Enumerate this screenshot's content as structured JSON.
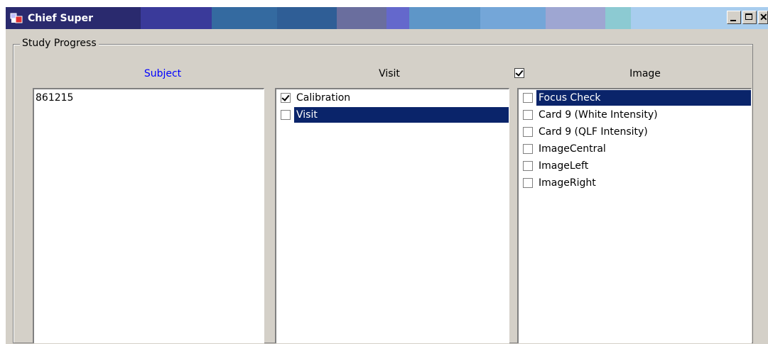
{
  "window": {
    "title": "Chief Super",
    "titlebar_colors": [
      "#2a2a6e",
      "#3a3a9a",
      "#346aa0",
      "#2f5e96",
      "#6a6e9e",
      "#6468cc",
      "#5e96c8",
      "#74a6d8",
      "#9ea6d2",
      "#8ccad2",
      "#a8cdee"
    ]
  },
  "group": {
    "label": "Study Progress"
  },
  "columns": {
    "subject_header": "Subject",
    "subject_header_color": "#0000ff",
    "visit_header": "Visit",
    "image_header": "Image",
    "image_header_checked": true
  },
  "subjects": [
    "861215"
  ],
  "visits": [
    {
      "label": "Calibration",
      "checked": true,
      "selected": false
    },
    {
      "label": "Visit",
      "checked": false,
      "selected": true
    }
  ],
  "images": [
    {
      "label": "Focus Check",
      "checked": false,
      "selected": true
    },
    {
      "label": "Card 9 (White Intensity)",
      "checked": false,
      "selected": false
    },
    {
      "label": "Card 9 (QLF Intensity)",
      "checked": false,
      "selected": false
    },
    {
      "label": "ImageCentral",
      "checked": false,
      "selected": false
    },
    {
      "label": "ImageLeft",
      "checked": false,
      "selected": false
    },
    {
      "label": "ImageRight",
      "checked": false,
      "selected": false
    }
  ],
  "icons": {
    "app": "app-flag-icon",
    "minimize": "minimize-icon",
    "maximize": "maximize-icon",
    "close": "close-icon"
  }
}
